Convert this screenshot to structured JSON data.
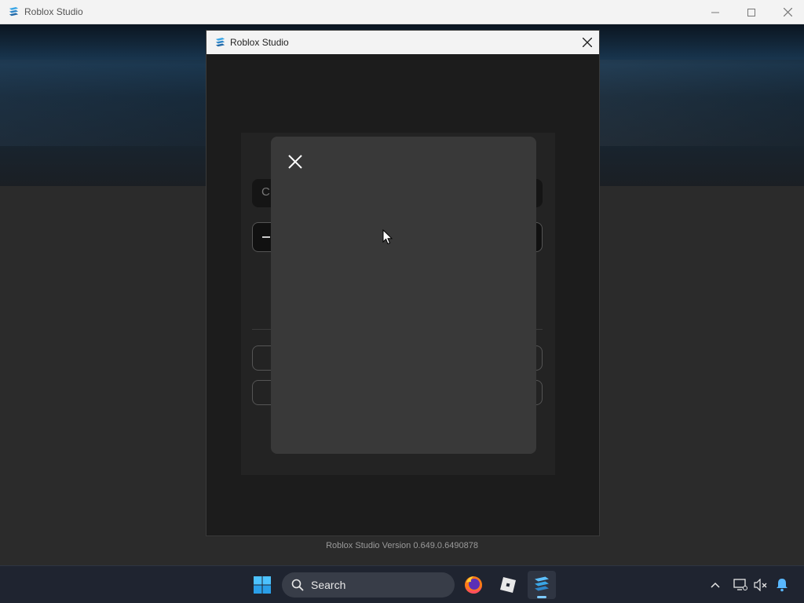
{
  "main_window": {
    "title": "Roblox Studio",
    "icon": "roblox-studio-icon",
    "controls": [
      "minimize-icon",
      "maximize-icon",
      "close-icon"
    ]
  },
  "dialog": {
    "title": "Roblox Studio",
    "icon": "roblox-studio-icon",
    "login": {
      "first_field_partial_text": "C"
    },
    "modal": {
      "close_icon": "close-icon"
    }
  },
  "footer": {
    "version": "Roblox Studio Version 0.649.0.6490878"
  },
  "taskbar": {
    "search_label": "Search",
    "apps": [
      "start-icon",
      "firefox-icon",
      "roblox-icon",
      "roblox-studio-icon"
    ],
    "tray": [
      "chevron-up-icon",
      "network-icon",
      "volume-muted-icon",
      "notification-bell-icon"
    ]
  },
  "colors": {
    "accent": "#2e9fdc",
    "bell": "#59b8ff"
  }
}
